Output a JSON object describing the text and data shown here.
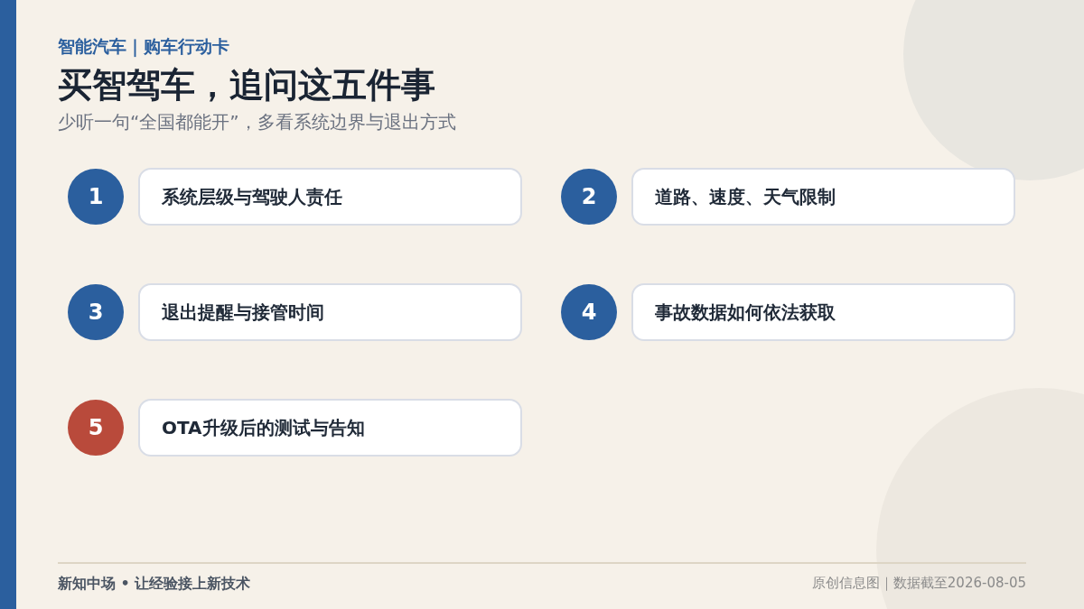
{
  "kicker": "智能汽车｜购车行动卡",
  "title": "买智驾车，追问这五件事",
  "subtitle": "少听一句“全国都能开”，多看系统边界与退出方式",
  "items": [
    {
      "number": "1",
      "text": "系统层级与驾驶人责任",
      "color": "#2b5f9e"
    },
    {
      "number": "2",
      "text": "道路、速度、天气限制",
      "color": "#2b5f9e"
    },
    {
      "number": "3",
      "text": "退出提醒与接管时间",
      "color": "#2b5f9e"
    },
    {
      "number": "4",
      "text": "事故数据如何依法获取",
      "color": "#2b5f9e"
    },
    {
      "number": "5",
      "text": "OTA升级后的测试与告知",
      "color": "#b94a3b"
    }
  ],
  "footer": {
    "brand": "新知中场 • 让经验接上新技术",
    "note": "原创信息图｜数据截至2026-08-05"
  }
}
